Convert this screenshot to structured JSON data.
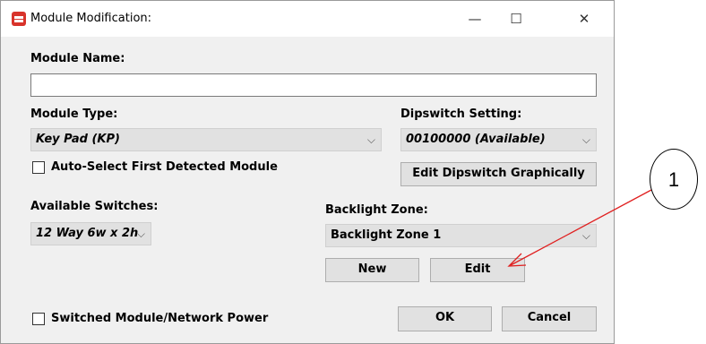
{
  "window": {
    "title": "Module Modification:",
    "minimize_glyph": "—",
    "maximize_glyph": "☐",
    "close_glyph": "✕"
  },
  "module_name": {
    "label": "Module Name:",
    "value": ""
  },
  "module_type": {
    "label": "Module Type:",
    "selected": "Key Pad (KP)"
  },
  "dipswitch": {
    "label": "Dipswitch Setting:",
    "selected": "00100000 (Available)",
    "edit_button": "Edit Dipswitch Graphically"
  },
  "auto_select": {
    "label": "Auto-Select First Detected Module",
    "checked": false
  },
  "available_switches": {
    "label": "Available Switches:",
    "selected": "12 Way 6w x 2h"
  },
  "backlight_zone": {
    "label": "Backlight Zone:",
    "selected": "Backlight Zone 1",
    "new_button": "New",
    "edit_button": "Edit"
  },
  "switched_power": {
    "label": "Switched Module/Network Power",
    "checked": false
  },
  "footer": {
    "ok": "OK",
    "cancel": "Cancel"
  },
  "callout": {
    "number": "1"
  },
  "colors": {
    "arrow": "#e02020",
    "dialog_bg": "#f0f0f0",
    "button_bg": "#e1e1e1"
  }
}
